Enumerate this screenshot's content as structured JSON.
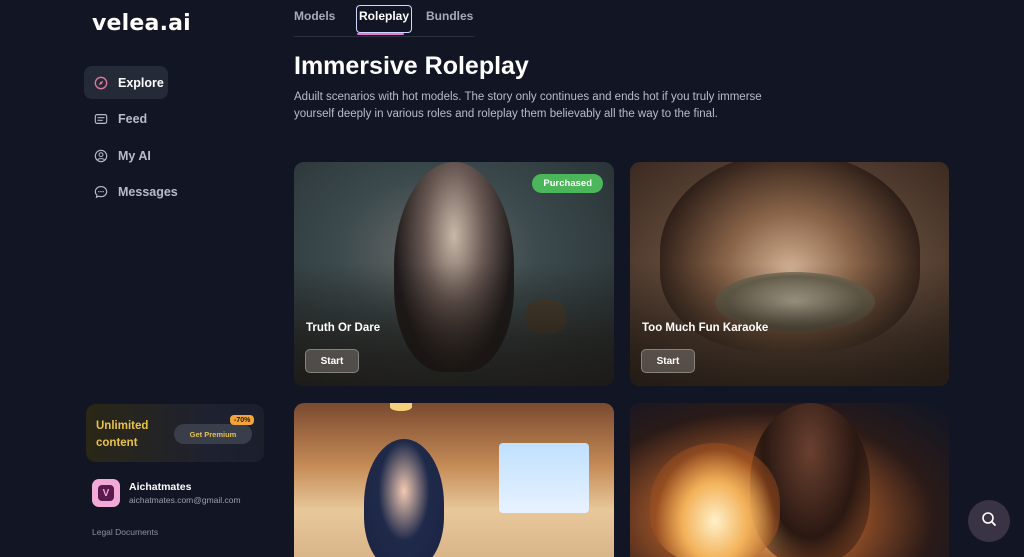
{
  "brand": {
    "logo_text": "velea.ai"
  },
  "sidebar": {
    "items": [
      {
        "label": "Explore",
        "icon": "compass-icon",
        "active": true
      },
      {
        "label": "Feed",
        "icon": "feed-icon",
        "active": false
      },
      {
        "label": "My AI",
        "icon": "user-circle-icon",
        "active": false
      },
      {
        "label": "Messages",
        "icon": "chat-bubble-icon",
        "active": false
      }
    ],
    "promo": {
      "text": "Unlimited content",
      "button_label": "Get Premium",
      "discount": "-70%"
    },
    "user": {
      "name": "Aichatmates",
      "email": "aichatmates.com@gmail.com",
      "avatar_letter": "V"
    },
    "legal_label": "Legal Documents"
  },
  "tabs": [
    {
      "label": "Models",
      "active": false
    },
    {
      "label": "Roleplay",
      "active": true
    },
    {
      "label": "Bundles",
      "active": false
    }
  ],
  "main": {
    "title": "Immersive Roleplay",
    "description": "Aduilt scenarios with hot models. The story only continues and ends hot if you truly immerse yourself deeply in various roles and roleplay them believably all the way to the final."
  },
  "cards": [
    {
      "title": "Truth Or Dare",
      "button_label": "Start",
      "badge": "Purchased"
    },
    {
      "title": "Too Much Fun Karaoke",
      "button_label": "Start",
      "badge": ""
    },
    {
      "title": "",
      "button_label": "",
      "badge": ""
    },
    {
      "title": "",
      "button_label": "",
      "badge": ""
    }
  ],
  "colors": {
    "background": "#121624",
    "active_tab_underline": "#e57ad4",
    "purchased_badge": "#4cb65a",
    "promo_text": "#e9c24b",
    "discount_badge": "#f2a33a"
  }
}
